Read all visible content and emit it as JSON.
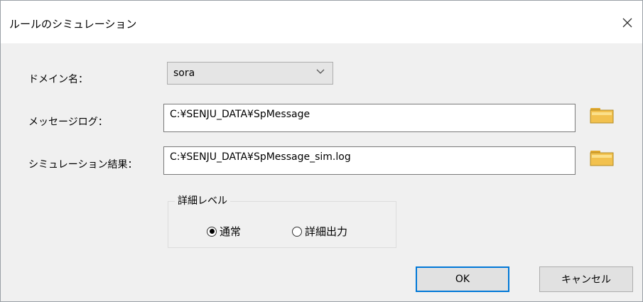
{
  "window": {
    "title": "ルールのシミュレーション"
  },
  "icons": {
    "close": "close-icon",
    "folder": "folder-icon",
    "dropdown": "chevron-down-icon"
  },
  "form": {
    "domain_label": "ドメイン名：",
    "domain_value": "sora",
    "message_log_label": "メッセージログ：",
    "message_log_value": "C:¥SENJU_DATA¥SpMessage",
    "sim_result_label": "シミュレーション結果：",
    "sim_result_value": "C:¥SENJU_DATA¥SpMessage_sim.log"
  },
  "detail_level": {
    "title": "詳細レベル",
    "options": [
      {
        "label": "通常",
        "selected": true
      },
      {
        "label": "詳細出力",
        "selected": false
      }
    ]
  },
  "buttons": {
    "ok": "OK",
    "cancel": "キャンセル"
  },
  "colors": {
    "focus_border": "#0078d7",
    "folder_icon": "#f2c14e"
  }
}
